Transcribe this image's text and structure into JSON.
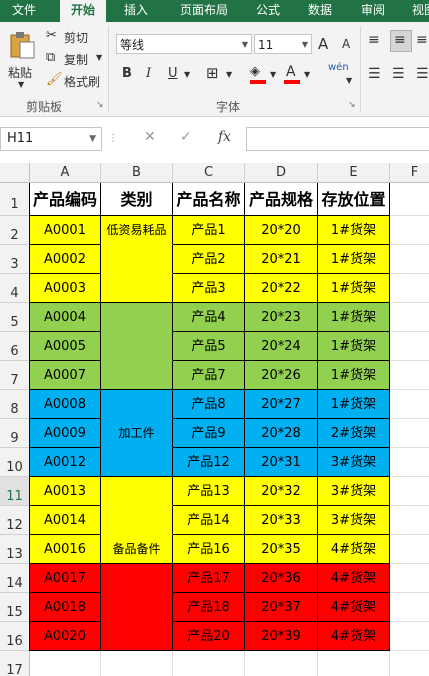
{
  "ribbon_tabs": [
    "文件",
    "开始",
    "插入",
    "页面布局",
    "公式",
    "数据",
    "审阅",
    "视图"
  ],
  "active_tab": "开始",
  "clipboard": {
    "paste": "粘贴",
    "cut": "剪切",
    "copy": "复制",
    "format_painter": "格式刷",
    "group_label": "剪贴板"
  },
  "font": {
    "family": "等线",
    "size": "11",
    "group_label": "字体",
    "bold": "B",
    "italic": "I",
    "underline": "U",
    "grow": "A",
    "shrink": "A",
    "phonetic": "wén"
  },
  "name_box": "H11",
  "column_headers": [
    "A",
    "B",
    "C",
    "D",
    "E",
    "F"
  ],
  "row_numbers": [
    "1",
    "2",
    "3",
    "4",
    "5",
    "6",
    "7",
    "8",
    "9",
    "10",
    "11",
    "12",
    "13",
    "14",
    "15",
    "16",
    "17"
  ],
  "selected_row": "11",
  "colors": {
    "yellow": "#ffff00",
    "green": "#92d050",
    "blue": "#00b0f0",
    "red": "#ff0000",
    "excel_green": "#217346"
  },
  "table": {
    "headers": [
      "产品编码",
      "类别",
      "产品名称",
      "产品规格",
      "存放位置"
    ],
    "rows": [
      {
        "code": "A0001",
        "name": "产品1",
        "spec": "20*20",
        "loc": "1#货架",
        "color": "yellow"
      },
      {
        "code": "A0002",
        "name": "产品2",
        "spec": "20*21",
        "loc": "1#货架",
        "color": "yellow"
      },
      {
        "code": "A0003",
        "name": "产品3",
        "spec": "20*22",
        "loc": "1#货架",
        "color": "yellow"
      },
      {
        "code": "A0004",
        "name": "产品4",
        "spec": "20*23",
        "loc": "1#货架",
        "color": "green"
      },
      {
        "code": "A0005",
        "name": "产品5",
        "spec": "20*24",
        "loc": "1#货架",
        "color": "green"
      },
      {
        "code": "A0007",
        "name": "产品7",
        "spec": "20*26",
        "loc": "1#货架",
        "color": "green"
      },
      {
        "code": "A0008",
        "name": "产品8",
        "spec": "20*27",
        "loc": "1#货架",
        "color": "blue"
      },
      {
        "code": "A0009",
        "name": "产品9",
        "spec": "20*28",
        "loc": "2#货架",
        "color": "blue"
      },
      {
        "code": "A0012",
        "name": "产品12",
        "spec": "20*31",
        "loc": "3#货架",
        "color": "blue"
      },
      {
        "code": "A0013",
        "name": "产品13",
        "spec": "20*32",
        "loc": "3#货架",
        "color": "yellow"
      },
      {
        "code": "A0014",
        "name": "产品14",
        "spec": "20*33",
        "loc": "3#货架",
        "color": "yellow"
      },
      {
        "code": "A0016",
        "name": "产品16",
        "spec": "20*35",
        "loc": "4#货架",
        "color": "yellow"
      },
      {
        "code": "A0017",
        "name": "产品17",
        "spec": "20*36",
        "loc": "4#货架",
        "color": "red"
      },
      {
        "code": "A0018",
        "name": "产品18",
        "spec": "20*37",
        "loc": "4#货架",
        "color": "red"
      },
      {
        "code": "A0020",
        "name": "产品20",
        "spec": "20*39",
        "loc": "4#货架",
        "color": "red"
      }
    ],
    "categories": [
      {
        "label": "低资易耗品",
        "color": "yellow",
        "label_row": 0,
        "rows": [
          0,
          1,
          2
        ]
      },
      {
        "label": "",
        "color": "green",
        "label_row": 0,
        "rows": [
          3,
          4,
          5
        ]
      },
      {
        "label": "加工件",
        "color": "blue",
        "label_row": 1,
        "rows": [
          6,
          7,
          8
        ]
      },
      {
        "label": "备品备件",
        "color": "yellow",
        "label_row": 2,
        "rows": [
          9,
          10,
          11
        ]
      },
      {
        "label": "",
        "color": "red",
        "label_row": 0,
        "rows": [
          12,
          13,
          14
        ]
      }
    ]
  }
}
